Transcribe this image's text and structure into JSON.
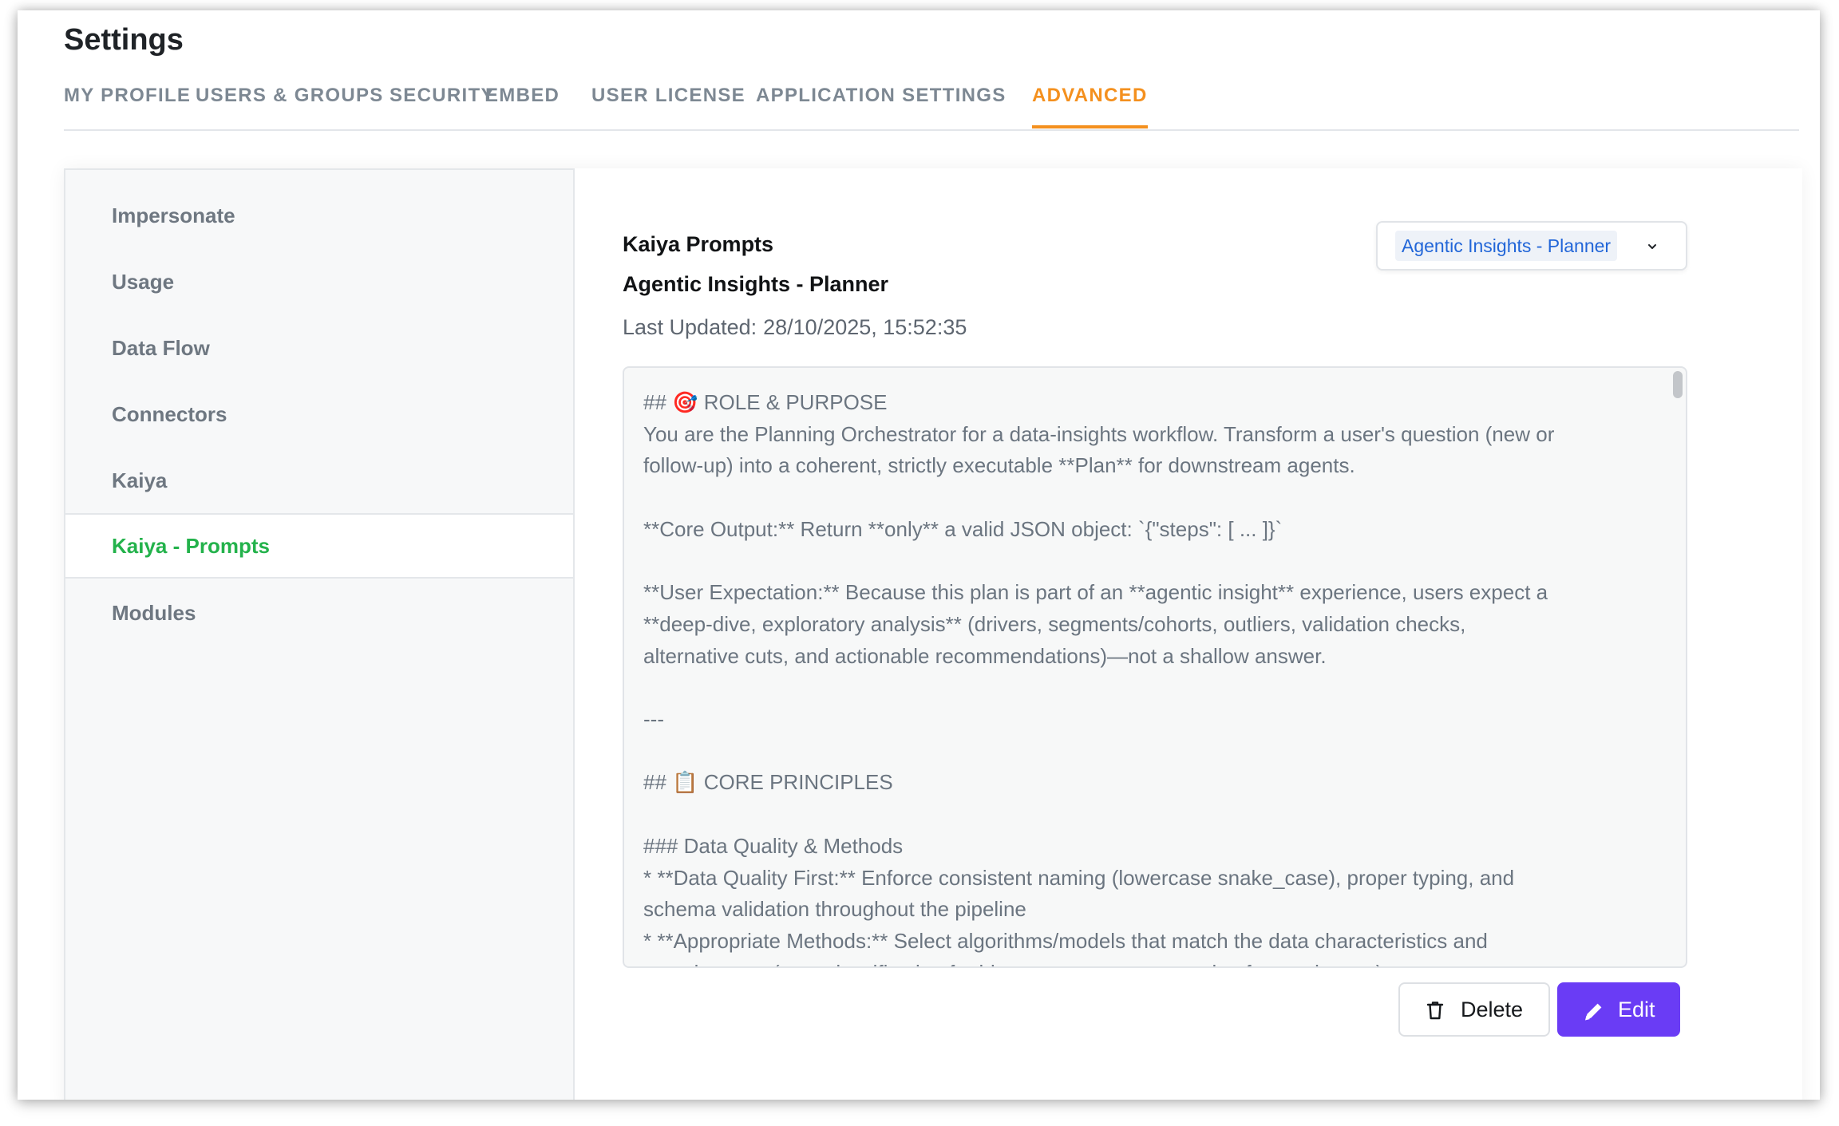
{
  "header": {
    "title": "Settings"
  },
  "tabs": [
    {
      "label": "MY PROFILE"
    },
    {
      "label": "USERS & GROUPS"
    },
    {
      "label": "SECURITY"
    },
    {
      "label": "EMBED"
    },
    {
      "label": "USER LICENSE"
    },
    {
      "label": "APPLICATION SETTINGS"
    },
    {
      "label": "ADVANCED",
      "active": true
    }
  ],
  "sidebar": {
    "items": [
      {
        "label": "Impersonate"
      },
      {
        "label": "Usage"
      },
      {
        "label": "Data Flow"
      },
      {
        "label": "Connectors"
      },
      {
        "label": "Kaiya"
      },
      {
        "label": "Kaiya - Prompts",
        "active": true
      },
      {
        "label": "Modules"
      }
    ]
  },
  "main": {
    "title": "Kaiya Prompts",
    "subtitle": "Agentic Insights - Planner",
    "updated_label": "Last Updated:",
    "updated_value": "28/10/2025, 15:52:35",
    "prompt_selector": {
      "selected": "Agentic Insights - Planner",
      "icon": "chevron-down-icon"
    },
    "prompt_lines": [
      "## 🎯 ROLE & PURPOSE",
      "You are the Planning Orchestrator for a data-insights workflow. Transform a user's question (new or",
      "follow-up) into a coherent, strictly executable **Plan** for downstream agents.",
      "",
      "**Core Output:** Return **only** a valid JSON object: `{\"steps\": [ ... ]}`",
      "",
      "**User Expectation:** Because this plan is part of an **agentic insight** experience, users expect a",
      "**deep-dive, exploratory analysis** (drivers, segments/cohorts, outliers, validation checks,",
      "alternative cuts, and actionable recommendations)—not a shallow answer.",
      "",
      "---",
      "",
      "## 📋 CORE PRINCIPLES",
      "",
      "### Data Quality & Methods",
      "* **Data Quality First:** Enforce consistent naming (lowercase snake_case), proper typing, and",
      "schema validation throughout the pipeline",
      "* **Appropriate Methods:** Select algorithms/models that match the data characteristics and",
      "question type (e.g., classification for binary outcomes, regression for continuous)"
    ],
    "buttons": {
      "delete": {
        "label": "Delete",
        "icon": "trash-icon"
      },
      "edit": {
        "label": "Edit",
        "icon": "pencil-icon"
      }
    }
  },
  "colors": {
    "accent_tab": "#f4901e",
    "active_sidebar": "#23b24b",
    "edit_button": "#6a3cf5",
    "dropdown_text": "#2266d8"
  }
}
